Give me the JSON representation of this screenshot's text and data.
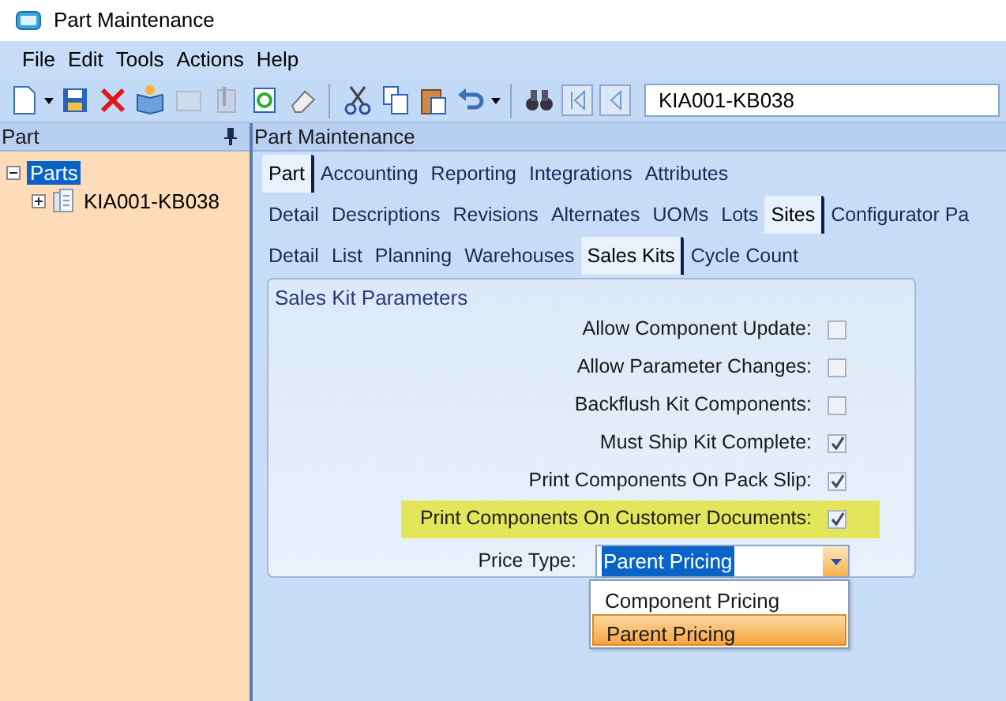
{
  "window": {
    "title": "Part Maintenance"
  },
  "menu": [
    "File",
    "Edit",
    "Tools",
    "Actions",
    "Help"
  ],
  "toolbar": {
    "tools": [
      {
        "kind": "new",
        "disabled": false
      },
      {
        "kind": "save",
        "disabled": false
      },
      {
        "kind": "delete",
        "disabled": false
      },
      {
        "kind": "book",
        "disabled": false
      },
      {
        "kind": "note",
        "disabled": true
      },
      {
        "kind": "clip",
        "disabled": true
      },
      {
        "kind": "refresh",
        "disabled": false
      },
      {
        "kind": "eraser",
        "disabled": false
      },
      {
        "kind": "sep"
      },
      {
        "kind": "cut",
        "disabled": false
      },
      {
        "kind": "copy",
        "disabled": false
      },
      {
        "kind": "paste",
        "disabled": false
      },
      {
        "kind": "undo",
        "disabled": false
      },
      {
        "kind": "sep"
      },
      {
        "kind": "find",
        "disabled": false
      },
      {
        "kind": "first",
        "disabled": false
      },
      {
        "kind": "prev",
        "disabled": false
      }
    ],
    "record": "KIA001-KB038"
  },
  "tree": {
    "header": "Part",
    "items": [
      {
        "label": "Parts",
        "selected": true,
        "expanded": true,
        "children": [
          {
            "label": "KIA001-KB038",
            "selected": false,
            "expanded": false
          }
        ]
      }
    ]
  },
  "main": {
    "title": "Part Maintenance",
    "tab_rows": [
      [
        {
          "label": "Part",
          "selected": true
        },
        {
          "label": "Accounting",
          "selected": false
        },
        {
          "label": "Reporting",
          "selected": false
        },
        {
          "label": "Integrations",
          "selected": false
        },
        {
          "label": "Attributes",
          "selected": false
        }
      ],
      [
        {
          "label": "Detail",
          "selected": false
        },
        {
          "label": "Descriptions",
          "selected": false
        },
        {
          "label": "Revisions",
          "selected": false
        },
        {
          "label": "Alternates",
          "selected": false
        },
        {
          "label": "UOMs",
          "selected": false
        },
        {
          "label": "Lots",
          "selected": false
        },
        {
          "label": "Sites",
          "selected": true
        },
        {
          "label": "Configurator Pa",
          "selected": false
        }
      ],
      [
        {
          "label": "Detail",
          "selected": false
        },
        {
          "label": "List",
          "selected": false
        },
        {
          "label": "Planning",
          "selected": false
        },
        {
          "label": "Warehouses",
          "selected": false
        },
        {
          "label": "Sales Kits",
          "selected": true
        },
        {
          "label": "Cycle Count",
          "selected": false
        }
      ]
    ],
    "group": {
      "title": "Sales Kit Parameters",
      "checkboxes": [
        {
          "label": "Allow Component Update:",
          "checked": false,
          "highlighted": false
        },
        {
          "label": "Allow Parameter Changes:",
          "checked": false,
          "highlighted": false
        },
        {
          "label": "Backflush Kit Components:",
          "checked": false,
          "highlighted": false
        },
        {
          "label": "Must Ship Kit Complete:",
          "checked": true,
          "highlighted": false
        },
        {
          "label": "Print Components On Pack Slip:",
          "checked": true,
          "highlighted": false
        },
        {
          "label": "Print Components On Customer Documents:",
          "checked": true,
          "highlighted": true
        }
      ],
      "price_type": {
        "label": "Price Type:",
        "value": "Parent Pricing",
        "expanded": true,
        "options": [
          {
            "label": "Component Pricing",
            "selected": false
          },
          {
            "label": "Parent Pricing",
            "selected": true
          }
        ]
      }
    }
  }
}
